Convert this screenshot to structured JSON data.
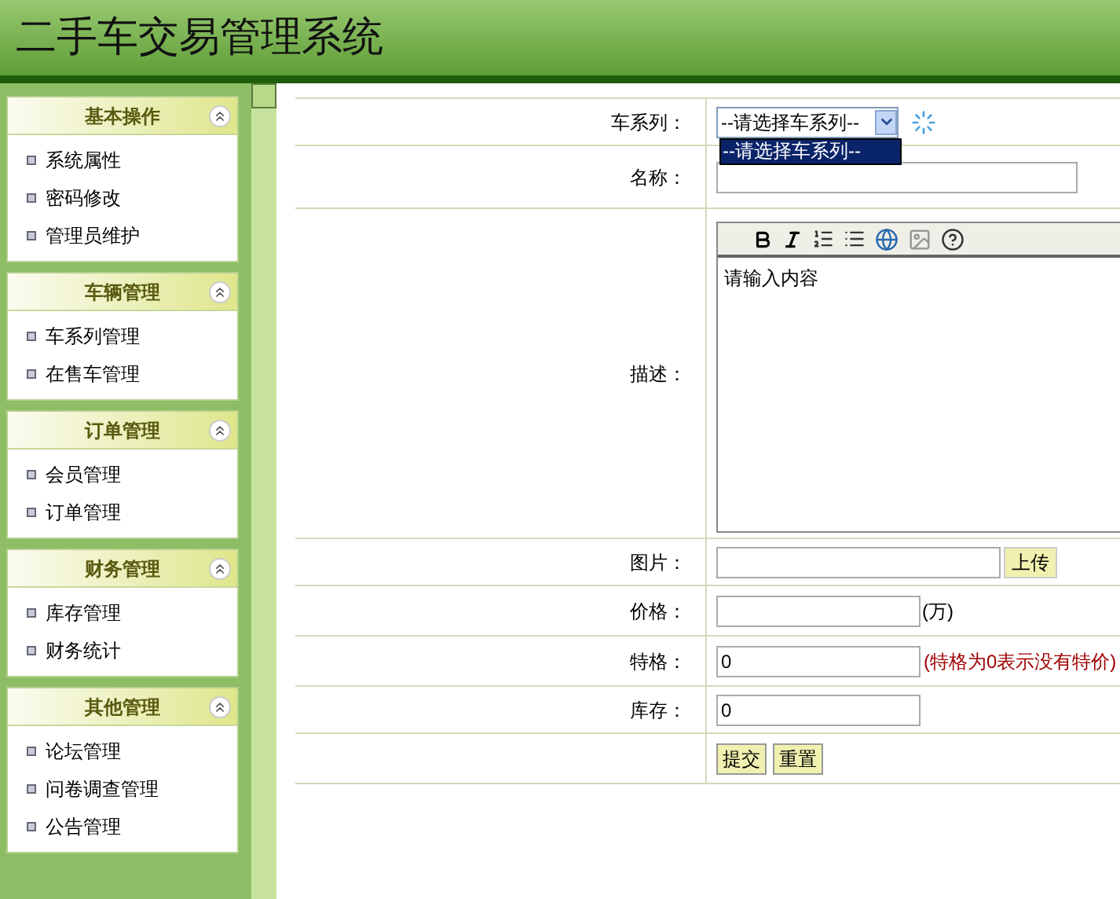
{
  "header": {
    "title": "二手车交易管理系统"
  },
  "sidebar": {
    "groups": [
      {
        "title": "基本操作",
        "expanded": true,
        "items": [
          {
            "label": "系统属性"
          },
          {
            "label": "密码修改"
          },
          {
            "label": "管理员维护"
          }
        ]
      },
      {
        "title": "车辆管理",
        "expanded": true,
        "items": [
          {
            "label": "车系列管理"
          },
          {
            "label": "在售车管理"
          }
        ]
      },
      {
        "title": "订单管理",
        "expanded": true,
        "items": [
          {
            "label": "会员管理"
          },
          {
            "label": "订单管理"
          }
        ]
      },
      {
        "title": "财务管理",
        "expanded": true,
        "items": [
          {
            "label": "库存管理"
          },
          {
            "label": "财务统计"
          }
        ]
      },
      {
        "title": "其他管理",
        "expanded": true,
        "items": [
          {
            "label": "论坛管理"
          },
          {
            "label": "问卷调查管理"
          },
          {
            "label": "公告管理"
          }
        ]
      }
    ]
  },
  "form": {
    "rows": [
      {
        "kind": "select",
        "label": "车系列：",
        "value": "--请选择车系列--",
        "open": true,
        "options": [
          {
            "label": "--请选择车系列--",
            "selected": true
          }
        ]
      },
      {
        "kind": "text",
        "label": "名称："
      },
      {
        "kind": "editor",
        "label": "描述：",
        "value": "请输入内容"
      },
      {
        "kind": "upload",
        "label": "图片：",
        "button": "上传"
      },
      {
        "kind": "text",
        "label": "价格：",
        "suffix": "(万)"
      },
      {
        "kind": "text",
        "label": "特格：",
        "value": "0",
        "note": "(特格为0表示没有特价)"
      },
      {
        "kind": "text",
        "label": "库存：",
        "value": "0"
      }
    ],
    "buttons": [
      "提交",
      "重置"
    ]
  }
}
